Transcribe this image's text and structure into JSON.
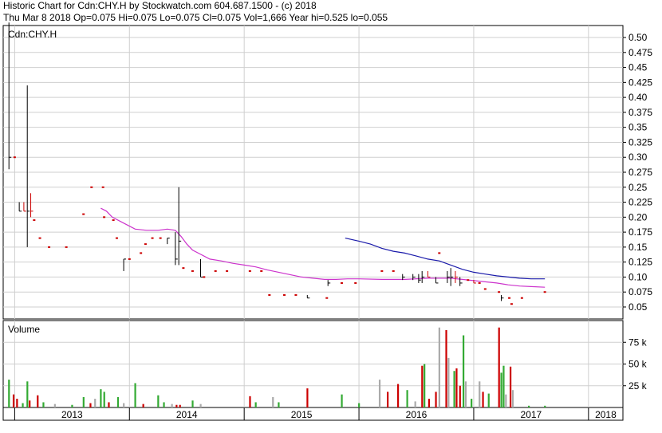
{
  "header": {
    "line1": "Historic Chart for Cdn:CHY.H by Stockwatch.com 604.687.1500 - (c) 2018",
    "line2": "Thu Mar  8 2018  Op=0.075  Hi=0.075  Lo=0.075  Cl=0.075  Vol=1,666  Year hi=0.525  lo=0.055"
  },
  "colors": {
    "price_up": "#000000",
    "price_down": "#cc0000",
    "ma_short": "#cc33cc",
    "ma_long": "#1a1aaa",
    "vol_up": "#33aa33",
    "vol_down": "#cc0000",
    "vol_flat": "#aaaaaa",
    "grid": "#cfcfcf"
  },
  "chart_data": [
    {
      "type": "line",
      "title": "Cdn:CHY.H",
      "ylim": [
        0.03,
        0.52
      ],
      "yticks": [
        "0.50",
        "0.475",
        "0.45",
        "0.425",
        "0.40",
        "0.375",
        "0.35",
        "0.325",
        "0.30",
        "0.275",
        "0.25",
        "0.225",
        "0.20",
        "0.175",
        "0.15",
        "0.125",
        "0.10",
        "0.075",
        "0.05"
      ],
      "xlim": [
        2012.9,
        2018.3
      ],
      "grid": true,
      "price_bars": [
        {
          "x": 2012.95,
          "hi": 0.525,
          "lo": 0.28,
          "c": 0.3,
          "up": true
        },
        {
          "x": 2013.0,
          "hi": 0.3,
          "lo": 0.3,
          "c": 0.3,
          "up": false
        },
        {
          "x": 2013.04,
          "hi": 0.225,
          "lo": 0.21,
          "c": 0.21,
          "up": true
        },
        {
          "x": 2013.08,
          "hi": 0.225,
          "lo": 0.21,
          "c": 0.21,
          "up": false
        },
        {
          "x": 2013.11,
          "hi": 0.42,
          "lo": 0.15,
          "c": 0.21,
          "up": true
        },
        {
          "x": 2013.14,
          "hi": 0.24,
          "lo": 0.2,
          "c": 0.21,
          "up": false
        },
        {
          "x": 2013.17,
          "hi": 0.195,
          "lo": 0.195,
          "c": 0.195,
          "up": false
        },
        {
          "x": 2013.22,
          "hi": 0.165,
          "lo": 0.165,
          "c": 0.165,
          "up": false
        },
        {
          "x": 2013.3,
          "hi": 0.15,
          "lo": 0.15,
          "c": 0.15,
          "up": false
        },
        {
          "x": 2013.45,
          "hi": 0.15,
          "lo": 0.15,
          "c": 0.15,
          "up": false
        },
        {
          "x": 2013.6,
          "hi": 0.205,
          "lo": 0.205,
          "c": 0.205,
          "up": false
        },
        {
          "x": 2013.67,
          "hi": 0.25,
          "lo": 0.25,
          "c": 0.25,
          "up": false
        },
        {
          "x": 2013.77,
          "hi": 0.25,
          "lo": 0.25,
          "c": 0.25,
          "up": false
        },
        {
          "x": 2013.78,
          "hi": 0.2,
          "lo": 0.2,
          "c": 0.2,
          "up": false
        },
        {
          "x": 2013.86,
          "hi": 0.195,
          "lo": 0.195,
          "c": 0.195,
          "up": false
        },
        {
          "x": 2013.89,
          "hi": 0.165,
          "lo": 0.165,
          "c": 0.165,
          "up": false
        },
        {
          "x": 2013.95,
          "hi": 0.13,
          "lo": 0.11,
          "c": 0.13,
          "up": true
        },
        {
          "x": 2014.0,
          "hi": 0.13,
          "lo": 0.13,
          "c": 0.13,
          "up": false
        },
        {
          "x": 2014.1,
          "hi": 0.14,
          "lo": 0.14,
          "c": 0.14,
          "up": false
        },
        {
          "x": 2014.14,
          "hi": 0.155,
          "lo": 0.155,
          "c": 0.155,
          "up": false
        },
        {
          "x": 2014.2,
          "hi": 0.165,
          "lo": 0.165,
          "c": 0.165,
          "up": false
        },
        {
          "x": 2014.27,
          "hi": 0.165,
          "lo": 0.165,
          "c": 0.165,
          "up": false
        },
        {
          "x": 2014.33,
          "hi": 0.165,
          "lo": 0.155,
          "c": 0.165,
          "up": true
        },
        {
          "x": 2014.4,
          "hi": 0.175,
          "lo": 0.12,
          "c": 0.13,
          "up": true
        },
        {
          "x": 2014.43,
          "hi": 0.25,
          "lo": 0.12,
          "c": 0.16,
          "up": true
        },
        {
          "x": 2014.47,
          "hi": 0.115,
          "lo": 0.115,
          "c": 0.115,
          "up": false
        },
        {
          "x": 2014.55,
          "hi": 0.11,
          "lo": 0.11,
          "c": 0.11,
          "up": false
        },
        {
          "x": 2014.62,
          "hi": 0.13,
          "lo": 0.1,
          "c": 0.1,
          "up": true
        },
        {
          "x": 2014.65,
          "hi": 0.1,
          "lo": 0.1,
          "c": 0.1,
          "up": false
        },
        {
          "x": 2014.75,
          "hi": 0.11,
          "lo": 0.11,
          "c": 0.11,
          "up": false
        },
        {
          "x": 2014.85,
          "hi": 0.11,
          "lo": 0.11,
          "c": 0.11,
          "up": false
        },
        {
          "x": 2015.05,
          "hi": 0.11,
          "lo": 0.11,
          "c": 0.11,
          "up": false
        },
        {
          "x": 2015.15,
          "hi": 0.11,
          "lo": 0.11,
          "c": 0.11,
          "up": false
        },
        {
          "x": 2015.22,
          "hi": 0.07,
          "lo": 0.07,
          "c": 0.07,
          "up": false
        },
        {
          "x": 2015.35,
          "hi": 0.07,
          "lo": 0.07,
          "c": 0.07,
          "up": false
        },
        {
          "x": 2015.45,
          "hi": 0.07,
          "lo": 0.07,
          "c": 0.07,
          "up": false
        },
        {
          "x": 2015.55,
          "hi": 0.07,
          "lo": 0.065,
          "c": 0.065,
          "up": true
        },
        {
          "x": 2015.72,
          "hi": 0.065,
          "lo": 0.065,
          "c": 0.065,
          "up": false
        },
        {
          "x": 2015.73,
          "hi": 0.095,
          "lo": 0.085,
          "c": 0.09,
          "up": true
        },
        {
          "x": 2015.85,
          "hi": 0.09,
          "lo": 0.09,
          "c": 0.09,
          "up": false
        },
        {
          "x": 2015.97,
          "hi": 0.09,
          "lo": 0.09,
          "c": 0.09,
          "up": false
        },
        {
          "x": 2016.2,
          "hi": 0.11,
          "lo": 0.11,
          "c": 0.11,
          "up": false
        },
        {
          "x": 2016.3,
          "hi": 0.11,
          "lo": 0.11,
          "c": 0.11,
          "up": false
        },
        {
          "x": 2016.38,
          "hi": 0.105,
          "lo": 0.095,
          "c": 0.1,
          "up": true
        },
        {
          "x": 2016.47,
          "hi": 0.105,
          "lo": 0.095,
          "c": 0.1,
          "up": true
        },
        {
          "x": 2016.52,
          "hi": 0.105,
          "lo": 0.09,
          "c": 0.095,
          "up": true
        },
        {
          "x": 2016.55,
          "hi": 0.11,
          "lo": 0.09,
          "c": 0.1,
          "up": true
        },
        {
          "x": 2016.6,
          "hi": 0.11,
          "lo": 0.1,
          "c": 0.1,
          "up": false
        },
        {
          "x": 2016.67,
          "hi": 0.1,
          "lo": 0.09,
          "c": 0.09,
          "up": true
        },
        {
          "x": 2016.7,
          "hi": 0.14,
          "lo": 0.14,
          "c": 0.14,
          "up": false
        },
        {
          "x": 2016.77,
          "hi": 0.11,
          "lo": 0.09,
          "c": 0.1,
          "up": true
        },
        {
          "x": 2016.8,
          "hi": 0.115,
          "lo": 0.085,
          "c": 0.1,
          "up": true
        },
        {
          "x": 2016.84,
          "hi": 0.11,
          "lo": 0.09,
          "c": 0.1,
          "up": false
        },
        {
          "x": 2016.88,
          "hi": 0.1,
          "lo": 0.085,
          "c": 0.09,
          "up": true
        },
        {
          "x": 2016.95,
          "hi": 0.095,
          "lo": 0.095,
          "c": 0.095,
          "up": false
        },
        {
          "x": 2017.0,
          "hi": 0.095,
          "lo": 0.09,
          "c": 0.09,
          "up": false
        },
        {
          "x": 2017.05,
          "hi": 0.09,
          "lo": 0.09,
          "c": 0.09,
          "up": false
        },
        {
          "x": 2017.1,
          "hi": 0.08,
          "lo": 0.08,
          "c": 0.08,
          "up": false
        },
        {
          "x": 2017.22,
          "hi": 0.075,
          "lo": 0.075,
          "c": 0.075,
          "up": false
        },
        {
          "x": 2017.24,
          "hi": 0.07,
          "lo": 0.06,
          "c": 0.065,
          "up": true
        },
        {
          "x": 2017.31,
          "hi": 0.065,
          "lo": 0.065,
          "c": 0.065,
          "up": false
        },
        {
          "x": 2017.33,
          "hi": 0.055,
          "lo": 0.055,
          "c": 0.055,
          "up": false
        },
        {
          "x": 2017.42,
          "hi": 0.065,
          "lo": 0.065,
          "c": 0.065,
          "up": false
        },
        {
          "x": 2017.62,
          "hi": 0.075,
          "lo": 0.075,
          "c": 0.075,
          "up": false
        }
      ],
      "series": [
        {
          "x": [
            2013.75,
            2013.8,
            2013.85,
            2013.95,
            2014.05,
            2014.15,
            2014.25,
            2014.33,
            2014.4,
            2014.45,
            2014.5,
            2014.55,
            2014.62,
            2014.7,
            2014.8,
            2014.9,
            2015.0,
            2015.1,
            2015.2,
            2015.3,
            2015.4,
            2015.5,
            2015.6,
            2015.7,
            2015.8,
            2015.9,
            2016.0,
            2016.2,
            2016.4,
            2016.6,
            2016.8,
            2016.9,
            2017.0,
            2017.1,
            2017.2,
            2017.3,
            2017.4,
            2017.5,
            2017.62
          ],
          "values": [
            0.215,
            0.21,
            0.2,
            0.19,
            0.18,
            0.178,
            0.178,
            0.18,
            0.178,
            0.168,
            0.155,
            0.145,
            0.138,
            0.13,
            0.127,
            0.123,
            0.12,
            0.117,
            0.112,
            0.108,
            0.104,
            0.1,
            0.098,
            0.096,
            0.096,
            0.097,
            0.097,
            0.096,
            0.096,
            0.098,
            0.098,
            0.096,
            0.094,
            0.092,
            0.09,
            0.087,
            0.085,
            0.084,
            0.083
          ]
        },
        {
          "x": [
            2015.88,
            2016.0,
            2016.1,
            2016.2,
            2016.3,
            2016.4,
            2016.5,
            2016.6,
            2016.7,
            2016.8,
            2016.9,
            2017.0,
            2017.1,
            2017.2,
            2017.3,
            2017.4,
            2017.5,
            2017.62
          ],
          "values": [
            0.165,
            0.16,
            0.155,
            0.148,
            0.143,
            0.14,
            0.135,
            0.13,
            0.127,
            0.12,
            0.113,
            0.108,
            0.105,
            0.102,
            0.1,
            0.098,
            0.097,
            0.097
          ]
        }
      ]
    },
    {
      "type": "bar",
      "title": "Volume",
      "ylim": [
        0,
        100000
      ],
      "yticks": [
        "75 k",
        "50 k",
        "25 k"
      ],
      "xtick_labels": [
        "2013",
        "2014",
        "2015",
        "2016",
        "2017",
        "2018"
      ],
      "bars": [
        {
          "x": 2012.95,
          "v": 32000,
          "c": "up"
        },
        {
          "x": 2012.99,
          "v": 15000,
          "c": "down"
        },
        {
          "x": 2013.02,
          "v": 10000,
          "c": "down"
        },
        {
          "x": 2013.07,
          "v": 5000,
          "c": "up"
        },
        {
          "x": 2013.11,
          "v": 30000,
          "c": "up"
        },
        {
          "x": 2013.13,
          "v": 8000,
          "c": "down"
        },
        {
          "x": 2013.2,
          "v": 14000,
          "c": "down"
        },
        {
          "x": 2013.25,
          "v": 6000,
          "c": "up"
        },
        {
          "x": 2013.35,
          "v": 4000,
          "c": "flat"
        },
        {
          "x": 2013.5,
          "v": 3000,
          "c": "up"
        },
        {
          "x": 2013.6,
          "v": 12000,
          "c": "up"
        },
        {
          "x": 2013.66,
          "v": 5000,
          "c": "down"
        },
        {
          "x": 2013.7,
          "v": 10000,
          "c": "flat"
        },
        {
          "x": 2013.75,
          "v": 21000,
          "c": "up"
        },
        {
          "x": 2013.78,
          "v": 18000,
          "c": "up"
        },
        {
          "x": 2013.82,
          "v": 6000,
          "c": "down"
        },
        {
          "x": 2013.9,
          "v": 12000,
          "c": "up"
        },
        {
          "x": 2013.95,
          "v": 5000,
          "c": "flat"
        },
        {
          "x": 2014.05,
          "v": 28000,
          "c": "up"
        },
        {
          "x": 2014.12,
          "v": 4000,
          "c": "down"
        },
        {
          "x": 2014.25,
          "v": 14000,
          "c": "up"
        },
        {
          "x": 2014.3,
          "v": 6000,
          "c": "up"
        },
        {
          "x": 2014.37,
          "v": 4000,
          "c": "flat"
        },
        {
          "x": 2014.41,
          "v": 3000,
          "c": "down"
        },
        {
          "x": 2014.44,
          "v": 3000,
          "c": "down"
        },
        {
          "x": 2014.55,
          "v": 8000,
          "c": "up"
        },
        {
          "x": 2014.62,
          "v": 4000,
          "c": "flat"
        },
        {
          "x": 2015.05,
          "v": 13000,
          "c": "down"
        },
        {
          "x": 2015.1,
          "v": 6000,
          "c": "up"
        },
        {
          "x": 2015.25,
          "v": 12000,
          "c": "flat"
        },
        {
          "x": 2015.3,
          "v": 6000,
          "c": "up"
        },
        {
          "x": 2015.55,
          "v": 22000,
          "c": "down"
        },
        {
          "x": 2015.85,
          "v": 15000,
          "c": "up"
        },
        {
          "x": 2016.0,
          "v": 5000,
          "c": "up"
        },
        {
          "x": 2016.18,
          "v": 32000,
          "c": "flat"
        },
        {
          "x": 2016.25,
          "v": 18000,
          "c": "down"
        },
        {
          "x": 2016.34,
          "v": 27000,
          "c": "down"
        },
        {
          "x": 2016.42,
          "v": 20000,
          "c": "up"
        },
        {
          "x": 2016.49,
          "v": 7000,
          "c": "flat"
        },
        {
          "x": 2016.55,
          "v": 48000,
          "c": "down"
        },
        {
          "x": 2016.57,
          "v": 50000,
          "c": "up"
        },
        {
          "x": 2016.61,
          "v": 10000,
          "c": "down"
        },
        {
          "x": 2016.67,
          "v": 18000,
          "c": "down"
        },
        {
          "x": 2016.7,
          "v": 92000,
          "c": "flat"
        },
        {
          "x": 2016.76,
          "v": 89000,
          "c": "down"
        },
        {
          "x": 2016.78,
          "v": 57000,
          "c": "flat"
        },
        {
          "x": 2016.83,
          "v": 42000,
          "c": "up"
        },
        {
          "x": 2016.85,
          "v": 45000,
          "c": "down"
        },
        {
          "x": 2016.88,
          "v": 25000,
          "c": "down"
        },
        {
          "x": 2016.91,
          "v": 83000,
          "c": "up"
        },
        {
          "x": 2016.93,
          "v": 30000,
          "c": "flat"
        },
        {
          "x": 2016.98,
          "v": 10000,
          "c": "up"
        },
        {
          "x": 2017.05,
          "v": 30000,
          "c": "flat"
        },
        {
          "x": 2017.08,
          "v": 18000,
          "c": "down"
        },
        {
          "x": 2017.13,
          "v": 16000,
          "c": "up"
        },
        {
          "x": 2017.22,
          "v": 92000,
          "c": "down"
        },
        {
          "x": 2017.24,
          "v": 40000,
          "c": "up"
        },
        {
          "x": 2017.26,
          "v": 48000,
          "c": "up"
        },
        {
          "x": 2017.28,
          "v": 15000,
          "c": "flat"
        },
        {
          "x": 2017.32,
          "v": 47000,
          "c": "down"
        },
        {
          "x": 2017.34,
          "v": 20000,
          "c": "flat"
        },
        {
          "x": 2017.48,
          "v": 2000,
          "c": "up"
        },
        {
          "x": 2017.62,
          "v": 2000,
          "c": "up"
        }
      ]
    }
  ]
}
